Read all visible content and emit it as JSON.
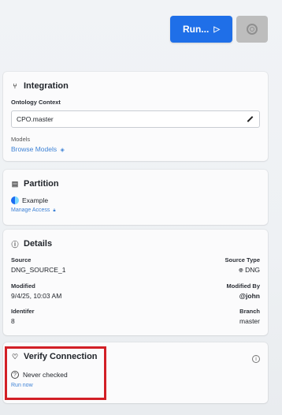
{
  "toolbar": {
    "run_label": "Run...",
    "run_icon": "▷"
  },
  "integration": {
    "title": "Integration",
    "ontology_context_label": "Ontology Context",
    "ontology_context_value": "CPO.master",
    "models_label": "Models",
    "browse_models_link": "Browse Models"
  },
  "partition": {
    "title": "Partition",
    "example_label": "Example",
    "manage_access_link": "Manage Access"
  },
  "details": {
    "title": "Details",
    "source_label": "Source",
    "source_value": "DNG_SOURCE_1",
    "source_type_label": "Source Type",
    "source_type_value": "DNG",
    "modified_label": "Modified",
    "modified_value": "9/4/25, 10:03 AM",
    "modified_by_label": "Modified By",
    "modified_by_value": "@john",
    "identifier_label": "Identifer",
    "identifier_value": "8",
    "branch_label": "Branch",
    "branch_value": "master"
  },
  "verify": {
    "title": "Verify Connection",
    "status": "Never checked",
    "run_now_link": "Run now"
  },
  "colors": {
    "primary_button": "#1f6fe8",
    "secondary_button": "#bdbdbd",
    "link": "#3f83d6",
    "highlight_border": "#d21f26"
  },
  "icons": {
    "run": "play-icon",
    "settings": "settings-icon",
    "integration": "branch-icon",
    "partition": "database-icon",
    "details": "info-icon",
    "verify": "heart-icon",
    "status": "question-circle-icon"
  }
}
